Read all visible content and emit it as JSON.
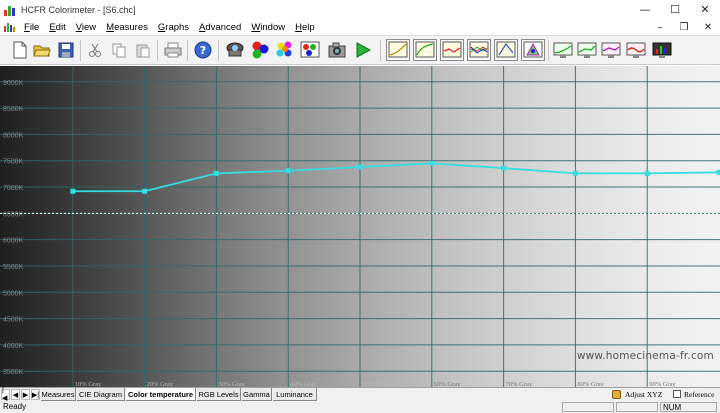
{
  "window": {
    "title": "HCFR Colorimeter - [S6.chc]",
    "controls": {
      "minimize": "—",
      "maximize": "☐",
      "close": "✕"
    }
  },
  "menubar": {
    "items": [
      {
        "pre": "",
        "key": "F",
        "post": "ile"
      },
      {
        "pre": "",
        "key": "E",
        "post": "dit"
      },
      {
        "pre": "",
        "key": "V",
        "post": "iew"
      },
      {
        "pre": "",
        "key": "M",
        "post": "easures"
      },
      {
        "pre": "",
        "key": "G",
        "post": "raphs"
      },
      {
        "pre": "",
        "key": "A",
        "post": "dvanced"
      },
      {
        "pre": "",
        "key": "W",
        "post": "indow"
      },
      {
        "pre": "",
        "key": "H",
        "post": "elp"
      }
    ],
    "doc_controls": {
      "minimize": "–",
      "restore": "❐",
      "close": "✕"
    }
  },
  "toolbar": {
    "icons": [
      "new-document-icon",
      "open-folder-icon",
      "save-icon",
      "cut-icon",
      "copy-icon",
      "paste-icon",
      "print-icon",
      "help-icon",
      "sensor-icon",
      "rgb-balls-icon",
      "color-palette-icon",
      "pattern-generator-icon",
      "camera-icon",
      "play-icon",
      "graph-luminance-icon",
      "graph-gamma-icon",
      "graph-color-temp-icon",
      "graph-rgb-levels-icon",
      "graph-cie-icon",
      "graph-saturation-icon",
      "graph-near-black-icon",
      "graph-near-white-icon",
      "graph-color-comparator-icon",
      "graph-delta-e-icon",
      "graph-measures-icon"
    ]
  },
  "chart_data": {
    "type": "line",
    "title": "",
    "y_tick_labels": [
      "9000K",
      "8500K",
      "8000K",
      "7500K",
      "7000K",
      "6500K",
      "6000K",
      "5500K",
      "5000K",
      "4500K",
      "4000K",
      "3500K"
    ],
    "x_tick_labels": [
      "10% Gray",
      "20% Gray",
      "30% Gray",
      "40% Gray",
      "50% Gray",
      "60% Gray",
      "70% Gray",
      "80% Gray",
      "90% Gray"
    ],
    "ylim": [
      3200,
      9300
    ],
    "x": [
      10,
      20,
      30,
      40,
      50,
      60,
      70,
      80,
      90,
      100
    ],
    "xlim": [
      0,
      100
    ],
    "series": [
      {
        "values": [
          6920,
          6920,
          7260,
          7310,
          7380,
          7450,
          7360,
          7260,
          7260,
          7280
        ]
      }
    ],
    "reference_line": 6500,
    "grid": true,
    "colors": {
      "series": "#33dde0",
      "reference": "#ffffff",
      "grid": "#2f6a6a"
    }
  },
  "watermark": "www.homecinema-fr.com",
  "tabs": {
    "nav": [
      "|◀",
      "◀",
      "▶",
      "▶|"
    ],
    "items": [
      "Measures",
      "CIE Diagram",
      "Color temperature",
      "RGB Levels",
      "Gamma",
      "Luminance"
    ],
    "active": "Color temperature",
    "adjust_label": "Adjust XYZ",
    "reference_label": "Reference"
  },
  "status": {
    "text": "Ready",
    "num": "NUM"
  }
}
